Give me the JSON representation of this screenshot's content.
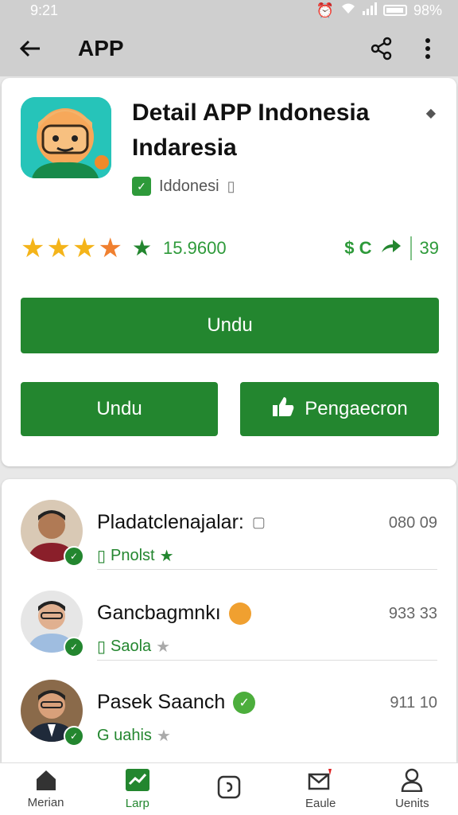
{
  "status": {
    "time": "9:21",
    "battery": "98%"
  },
  "appbar": {
    "title": "APP",
    "back_icon": "arrow-left-icon",
    "share_icon": "share-icon",
    "menu_icon": "more-vert-icon"
  },
  "app": {
    "name_line1": "Detail APP Indonesia",
    "name_line2": "Indaresia",
    "developer": "Iddonesi",
    "rating_count": "15.9600",
    "stat_value": "39",
    "stat_symbols": "$ C"
  },
  "buttons": {
    "main": "Undu",
    "secondary": "Undu",
    "tertiary": "Pengaecron"
  },
  "reviews": [
    {
      "name": "Pladatclenajalar:",
      "meta": "Pnolst",
      "value": "080 09"
    },
    {
      "name": "Gancbagmnkı",
      "meta": "Saola",
      "value": "933 33"
    },
    {
      "name": "Pasek Saanch",
      "meta": "G uahis",
      "value": "911 10"
    }
  ],
  "nav": [
    {
      "label": "Merian",
      "icon": "home-icon"
    },
    {
      "label": "Larp",
      "icon": "chart-icon"
    },
    {
      "label": "",
      "icon": "chat-icon"
    },
    {
      "label": "Eaule",
      "icon": "mail-alert-icon"
    },
    {
      "label": "Uenits",
      "icon": "person-icon"
    }
  ],
  "colors": {
    "accent": "#23862f",
    "star_gold": "#f4b41a",
    "star_orange": "#f08030"
  }
}
